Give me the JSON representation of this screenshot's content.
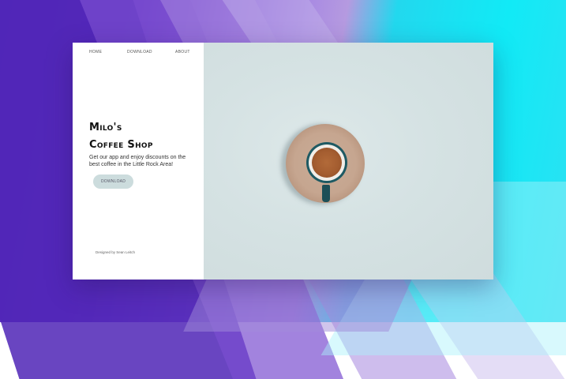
{
  "nav": {
    "home": "HOME",
    "download": "DOWNLOAD",
    "about": "ABOUT"
  },
  "hero": {
    "title_line1": "Milo's",
    "title_line2": "Coffee Shop",
    "subtitle": "Get our app and enjoy discounts on the best coffee in the Little Rock Area!",
    "button_label": "DOWNLOAD"
  },
  "footer": {
    "credit": "Designed by Sean Leitch"
  },
  "colors": {
    "button_bg": "#ccdcdd",
    "photo_bg": "#d5e2e3",
    "mug": "#1e5a63",
    "saucer": "#c6a690"
  }
}
